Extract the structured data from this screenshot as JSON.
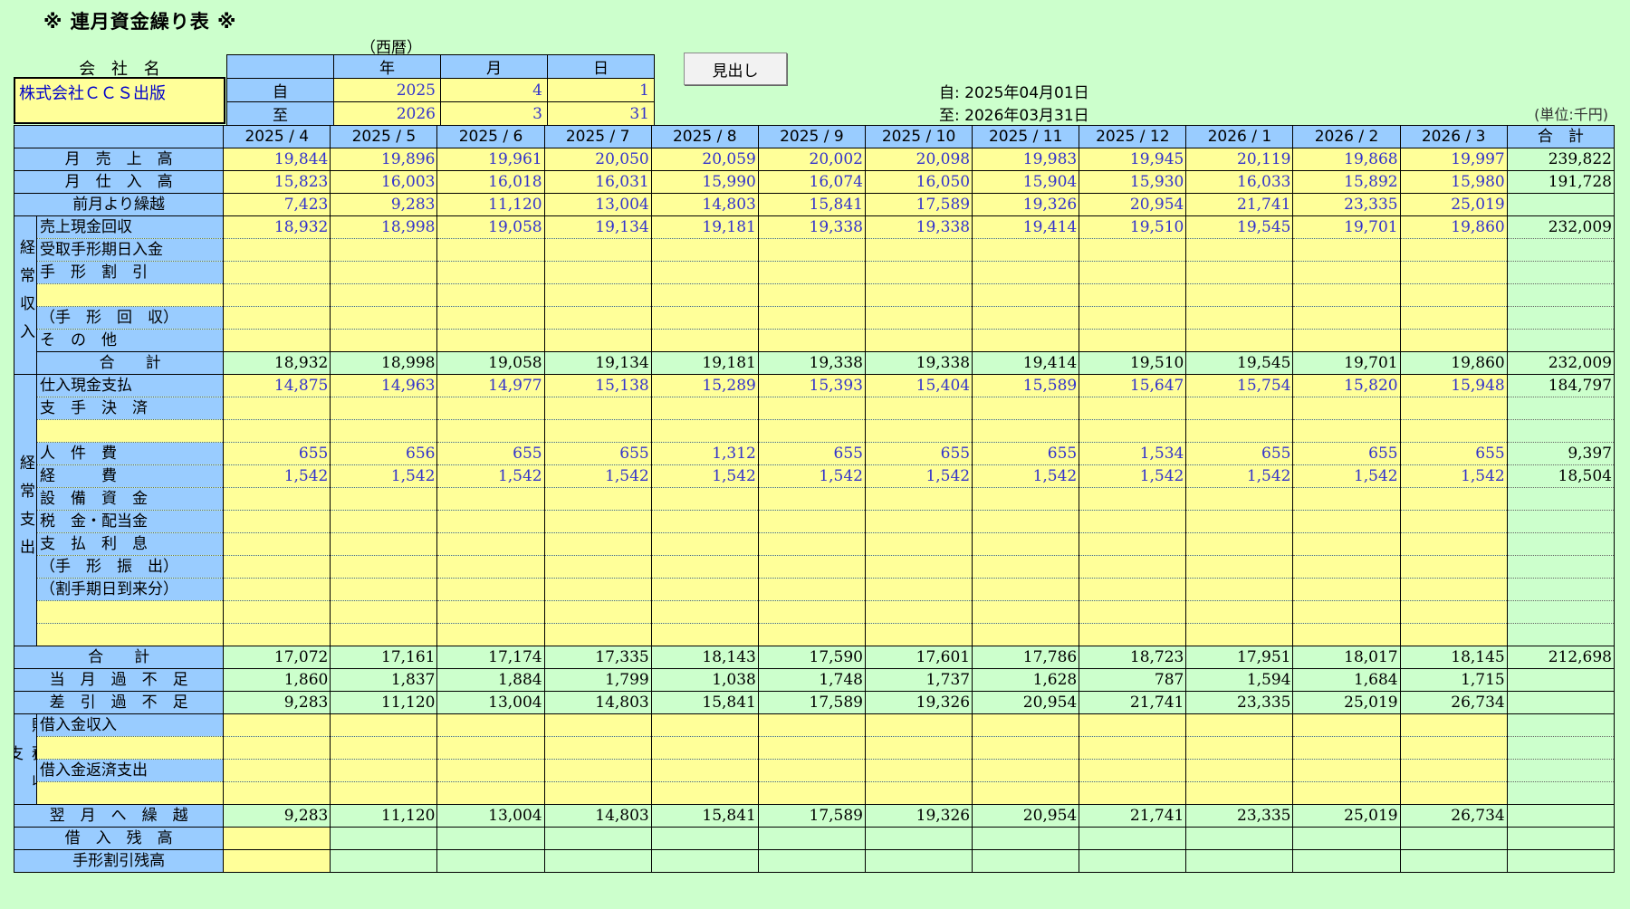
{
  "title": "※ 連月資金繰り表 ※",
  "seireki": "（西暦）",
  "company_label": "会 社 名",
  "company_name": "株式会社ＣＣＳ出版",
  "date_header": {
    "year": "年",
    "month": "月",
    "day": "日"
  },
  "from": {
    "label": "自",
    "year": "2025",
    "month": "4",
    "day": "1"
  },
  "to": {
    "label": "至",
    "year": "2026",
    "month": "3",
    "day": "31"
  },
  "midashi_button": "見出し",
  "period_from": "自: 2025年04月01日",
  "period_to": "至: 2026年03月31日",
  "unit": "(単位:千円)",
  "months": [
    "2025 / 4",
    "2025 / 5",
    "2025 / 6",
    "2025 / 7",
    "2025 / 8",
    "2025 / 9",
    "2025 / 10",
    "2025 / 11",
    "2025 / 12",
    "2026 / 1",
    "2026 / 2",
    "2026 / 3"
  ],
  "total_header": "合　計",
  "sections": {
    "income": "経常収入",
    "expense": "経常支出",
    "finance": "財務収支"
  },
  "rows": [
    {
      "label": "月　売　上　高",
      "values": [
        "19,844",
        "19,896",
        "19,961",
        "20,050",
        "20,059",
        "20,002",
        "20,098",
        "19,983",
        "19,945",
        "20,119",
        "19,868",
        "19,997"
      ],
      "total": "239,822"
    },
    {
      "label": "月　仕　入　高",
      "values": [
        "15,823",
        "16,003",
        "16,018",
        "16,031",
        "15,990",
        "16,074",
        "16,050",
        "15,904",
        "15,930",
        "16,033",
        "15,892",
        "15,980"
      ],
      "total": "191,728"
    },
    {
      "label": "前月より繰越",
      "values": [
        "7,423",
        "9,283",
        "11,120",
        "13,004",
        "14,803",
        "15,841",
        "17,589",
        "19,326",
        "20,954",
        "21,741",
        "23,335",
        "25,019"
      ],
      "total": ""
    },
    {
      "label": "売上現金回収",
      "values": [
        "18,932",
        "18,998",
        "19,058",
        "19,134",
        "19,181",
        "19,338",
        "19,338",
        "19,414",
        "19,510",
        "19,545",
        "19,701",
        "19,860"
      ],
      "total": "232,009"
    },
    {
      "label": "受取手形期日入金",
      "values": [
        "",
        "",
        "",
        "",
        "",
        "",
        "",
        "",
        "",
        "",
        "",
        ""
      ],
      "total": ""
    },
    {
      "label": "手　形　割　引",
      "values": [
        "",
        "",
        "",
        "",
        "",
        "",
        "",
        "",
        "",
        "",
        "",
        ""
      ],
      "total": ""
    },
    {
      "label": "",
      "values": [
        "",
        "",
        "",
        "",
        "",
        "",
        "",
        "",
        "",
        "",
        "",
        ""
      ],
      "total": ""
    },
    {
      "label": "（手　形　回　収）",
      "values": [
        "",
        "",
        "",
        "",
        "",
        "",
        "",
        "",
        "",
        "",
        "",
        ""
      ],
      "total": ""
    },
    {
      "label": "そ　の　他",
      "values": [
        "",
        "",
        "",
        "",
        "",
        "",
        "",
        "",
        "",
        "",
        "",
        ""
      ],
      "total": ""
    },
    {
      "label": "合　　計",
      "values": [
        "18,932",
        "18,998",
        "19,058",
        "19,134",
        "19,181",
        "19,338",
        "19,338",
        "19,414",
        "19,510",
        "19,545",
        "19,701",
        "19,860"
      ],
      "total": "232,009"
    },
    {
      "label": "仕入現金支払",
      "values": [
        "14,875",
        "14,963",
        "14,977",
        "15,138",
        "15,289",
        "15,393",
        "15,404",
        "15,589",
        "15,647",
        "15,754",
        "15,820",
        "15,948"
      ],
      "total": "184,797"
    },
    {
      "label": "支　手　決　済",
      "values": [
        "",
        "",
        "",
        "",
        "",
        "",
        "",
        "",
        "",
        "",
        "",
        ""
      ],
      "total": ""
    },
    {
      "label": "",
      "values": [
        "",
        "",
        "",
        "",
        "",
        "",
        "",
        "",
        "",
        "",
        "",
        ""
      ],
      "total": ""
    },
    {
      "label": "人　件　費",
      "values": [
        "655",
        "656",
        "655",
        "655",
        "1,312",
        "655",
        "655",
        "655",
        "1,534",
        "655",
        "655",
        "655"
      ],
      "total": "9,397"
    },
    {
      "label": "経　　　費",
      "values": [
        "1,542",
        "1,542",
        "1,542",
        "1,542",
        "1,542",
        "1,542",
        "1,542",
        "1,542",
        "1,542",
        "1,542",
        "1,542",
        "1,542"
      ],
      "total": "18,504"
    },
    {
      "label": "設　備　資　金",
      "values": [
        "",
        "",
        "",
        "",
        "",
        "",
        "",
        "",
        "",
        "",
        "",
        ""
      ],
      "total": ""
    },
    {
      "label": "税　金・配当金",
      "values": [
        "",
        "",
        "",
        "",
        "",
        "",
        "",
        "",
        "",
        "",
        "",
        ""
      ],
      "total": ""
    },
    {
      "label": "支　払　利　息",
      "values": [
        "",
        "",
        "",
        "",
        "",
        "",
        "",
        "",
        "",
        "",
        "",
        ""
      ],
      "total": ""
    },
    {
      "label": "（手　形　振　出）",
      "values": [
        "",
        "",
        "",
        "",
        "",
        "",
        "",
        "",
        "",
        "",
        "",
        ""
      ],
      "total": ""
    },
    {
      "label": "（割手期日到来分）",
      "values": [
        "",
        "",
        "",
        "",
        "",
        "",
        "",
        "",
        "",
        "",
        "",
        ""
      ],
      "total": ""
    },
    {
      "label": "",
      "values": [
        "",
        "",
        "",
        "",
        "",
        "",
        "",
        "",
        "",
        "",
        "",
        ""
      ],
      "total": ""
    },
    {
      "label": "",
      "values": [
        "",
        "",
        "",
        "",
        "",
        "",
        "",
        "",
        "",
        "",
        "",
        ""
      ],
      "total": ""
    },
    {
      "label": "合　　計",
      "values": [
        "17,072",
        "17,161",
        "17,174",
        "17,335",
        "18,143",
        "17,590",
        "17,601",
        "17,786",
        "18,723",
        "17,951",
        "18,017",
        "18,145"
      ],
      "total": "212,698"
    },
    {
      "label": "当　月　過　不　足",
      "values": [
        "1,860",
        "1,837",
        "1,884",
        "1,799",
        "1,038",
        "1,748",
        "1,737",
        "1,628",
        "787",
        "1,594",
        "1,684",
        "1,715"
      ],
      "total": ""
    },
    {
      "label": "差　引　過　不　足",
      "values": [
        "9,283",
        "11,120",
        "13,004",
        "14,803",
        "15,841",
        "17,589",
        "19,326",
        "20,954",
        "21,741",
        "23,335",
        "25,019",
        "26,734"
      ],
      "total": ""
    },
    {
      "label": "借入金収入",
      "values": [
        "",
        "",
        "",
        "",
        "",
        "",
        "",
        "",
        "",
        "",
        "",
        ""
      ],
      "total": ""
    },
    {
      "label": "",
      "values": [
        "",
        "",
        "",
        "",
        "",
        "",
        "",
        "",
        "",
        "",
        "",
        ""
      ],
      "total": ""
    },
    {
      "label": "借入金返済支出",
      "values": [
        "",
        "",
        "",
        "",
        "",
        "",
        "",
        "",
        "",
        "",
        "",
        ""
      ],
      "total": ""
    },
    {
      "label": "",
      "values": [
        "",
        "",
        "",
        "",
        "",
        "",
        "",
        "",
        "",
        "",
        "",
        ""
      ],
      "total": ""
    },
    {
      "label": "翌　月　へ　繰　越",
      "values": [
        "9,283",
        "11,120",
        "13,004",
        "14,803",
        "15,841",
        "17,589",
        "19,326",
        "20,954",
        "21,741",
        "23,335",
        "25,019",
        "26,734"
      ],
      "total": ""
    },
    {
      "label": "借　入　残　高",
      "values": [
        "",
        "",
        "",
        "",
        "",
        "",
        "",
        "",
        "",
        "",
        "",
        ""
      ],
      "total": ""
    },
    {
      "label": "手形割引残高",
      "values": [
        "",
        "",
        "",
        "",
        "",
        "",
        "",
        "",
        "",
        "",
        "",
        ""
      ],
      "total": ""
    }
  ]
}
